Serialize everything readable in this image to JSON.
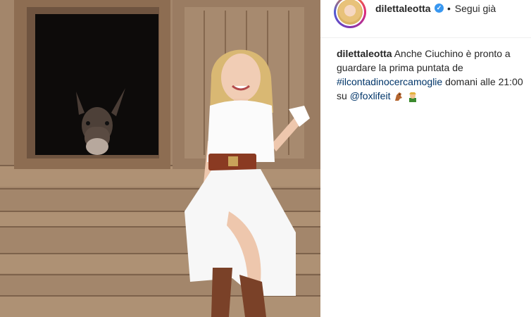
{
  "post": {
    "username": "dilettaleotta",
    "verified_icon": "verified-badge-icon",
    "follow_separator": "•",
    "follow_label": "Segui già"
  },
  "caption": {
    "username": "dilettaleotta",
    "text_1": "Anche Ciuchino è pronto a guardare la prima puntata de",
    "hashtag": "#ilcontadinocercamoglie",
    "text_2": "domani alle 21:00 su",
    "mention": "@foxlifeit",
    "emojis": [
      "horse-emoji",
      "farmer-emoji"
    ]
  },
  "colors": {
    "link": "#003569",
    "verified": "#3897f0",
    "text": "#262626"
  }
}
